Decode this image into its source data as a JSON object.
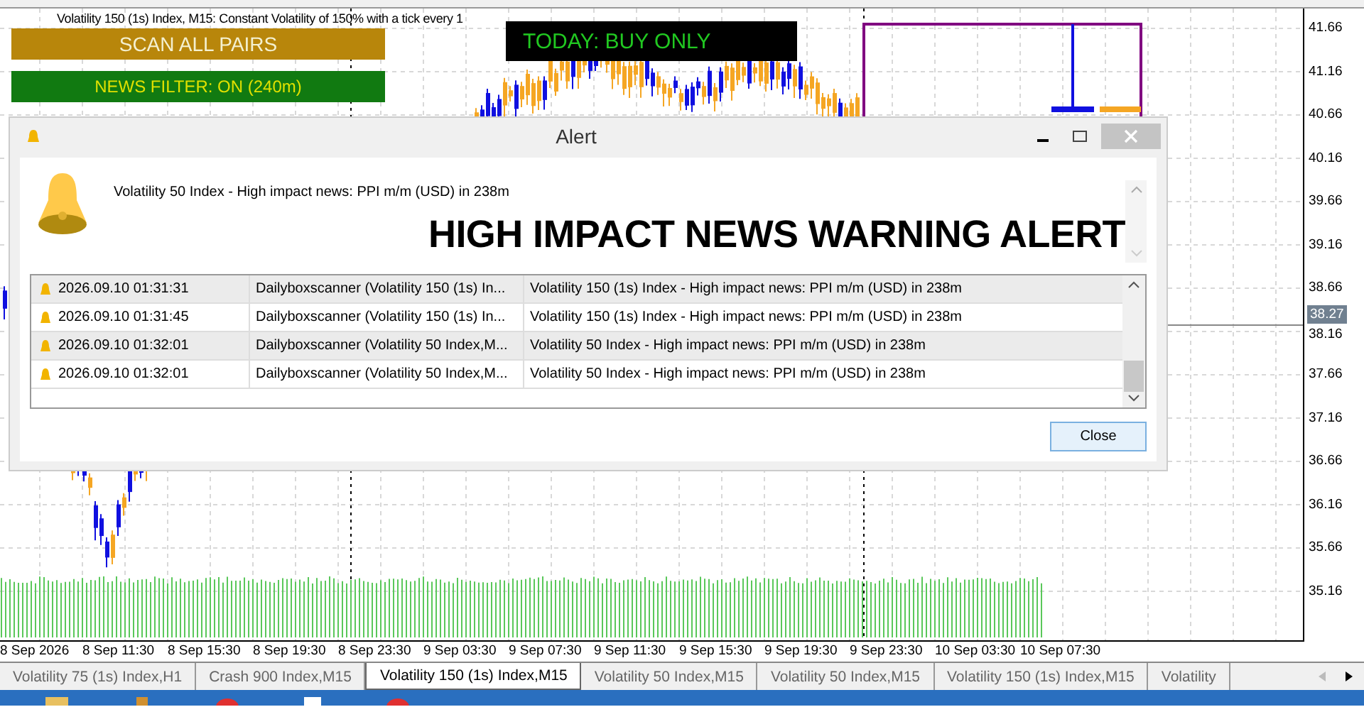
{
  "chart": {
    "title": "Volatility 150 (1s) Index, M15:  Constant Volatility of 150% with a tick every 1"
  },
  "buttons": [
    {
      "label": "SCAN ALL PAIRS",
      "kind": "scan"
    },
    {
      "label": "NEWS FILTER: ON  (240m)",
      "kind": "news"
    }
  ],
  "signal": "TODAY: BUY ONLY",
  "price_axis": [
    "41.66",
    "41.16",
    "40.66",
    "40.16",
    "39.66",
    "39.16",
    "38.66",
    "38.16",
    "37.66",
    "37.16",
    "36.66",
    "36.16",
    "35.66",
    "35.16"
  ],
  "current_price": "38.27",
  "time_axis": [
    "8 Sep 2026",
    "8 Sep 11:30",
    "8 Sep 15:30",
    "8 Sep 19:30",
    "8 Sep 23:30",
    "9 Sep 03:30",
    "9 Sep 07:30",
    "9 Sep 11:30",
    "9 Sep 15:30",
    "9 Sep 19:30",
    "9 Sep 23:30",
    "10 Sep 03:30",
    "10 Sep 07:30"
  ],
  "alert": {
    "title": "Alert",
    "message": "Volatility 50 Index - High impact news: PPI m/m (USD) in 238m",
    "heading": "HIGH IMPACT NEWS WARNING ALERT",
    "rows": [
      {
        "time": "2026.09.10 01:31:31",
        "source": "Dailyboxscanner (Volatility 150 (1s) In...",
        "message": "Volatility 150 (1s) Index - High impact news: PPI m/m (USD) in 238m"
      },
      {
        "time": "2026.09.10 01:31:45",
        "source": "Dailyboxscanner (Volatility 150 (1s) In...",
        "message": "Volatility 150 (1s) Index - High impact news: PPI m/m (USD) in 238m"
      },
      {
        "time": "2026.09.10 01:32:01",
        "source": "Dailyboxscanner (Volatility 50 Index,M...",
        "message": "Volatility 50 Index - High impact news: PPI m/m (USD) in 238m"
      },
      {
        "time": "2026.09.10 01:32:01",
        "source": "Dailyboxscanner (Volatility 50 Index,M...",
        "message": "Volatility 50 Index - High impact news: PPI m/m (USD) in 238m"
      }
    ],
    "close_button": "Close"
  },
  "tabs": [
    {
      "label": "Volatility 75 (1s) Index,H1",
      "selected": false
    },
    {
      "label": "Crash 900 Index,M15",
      "selected": false
    },
    {
      "label": "Volatility 150 (1s) Index,M15",
      "selected": true
    },
    {
      "label": "Volatility 50 Index,M15",
      "selected": false
    },
    {
      "label": "Volatility 50 Index,M15",
      "selected": false
    },
    {
      "label": "Volatility 150 (1s) Index,M15",
      "selected": false
    },
    {
      "label": "Volatility",
      "selected": false
    }
  ]
}
